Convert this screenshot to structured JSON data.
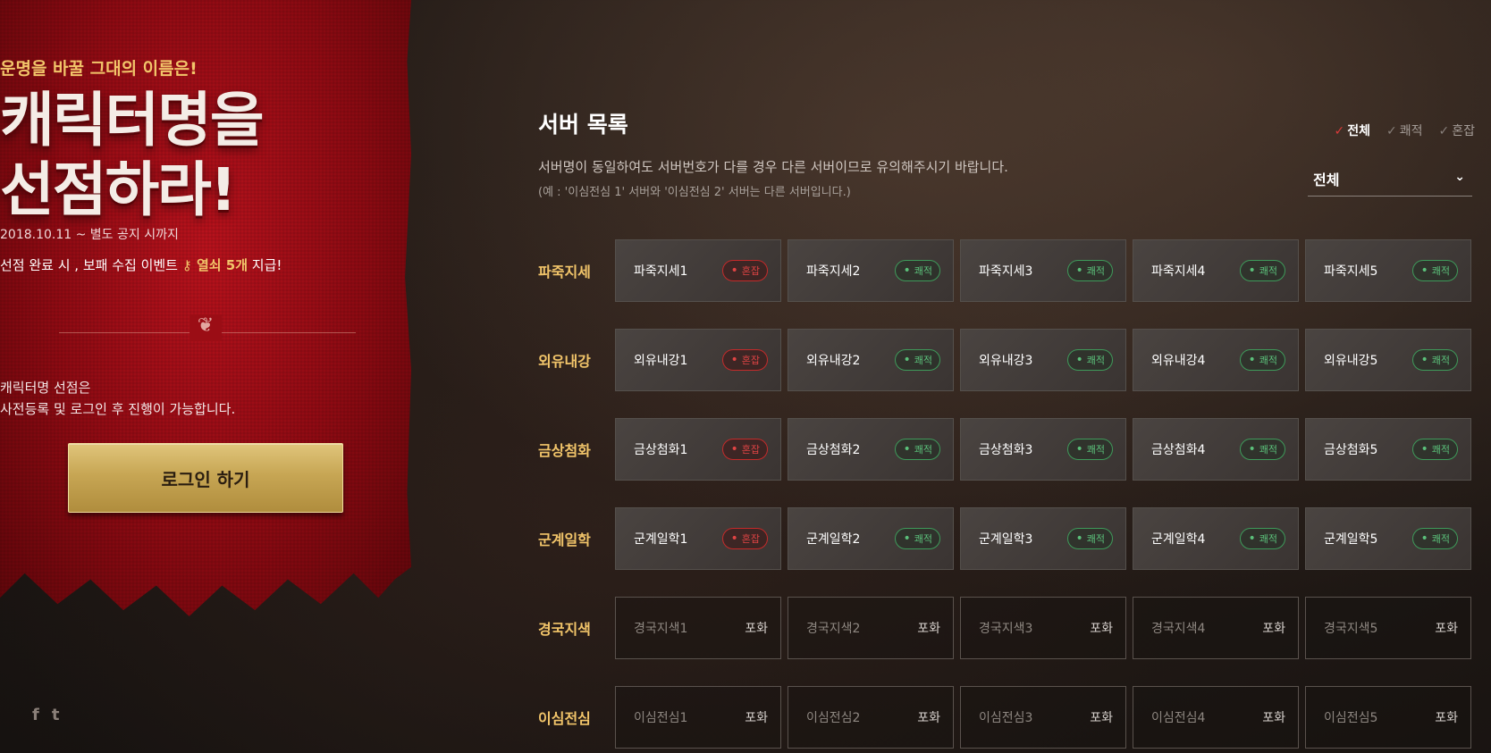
{
  "banner": {
    "tagline": "운명을 바꿀 그대의 이름은!",
    "headline_line1": "캐릭터명을",
    "headline_line2": "선점하라!",
    "period": "2018.10.11 ~ 별도 공지 시까지",
    "event_prefix": "선점 완료 시 , 보패 수집 이벤트 ",
    "event_key": "열쇠 5개",
    "event_suffix": " 지급!",
    "notice_line1": "캐릭터명 선점은",
    "notice_line2": "사전등록 및 로그인 후 진행이 가능합니다.",
    "login_label": "로그인 하기"
  },
  "social": {
    "facebook": "f",
    "twitter": "t"
  },
  "panel": {
    "title": "서버 목록",
    "description": "서버명이 동일하여도 서버번호가 다를 경우 다른 서버이므로 유의해주시기 바랍니다.",
    "description_sub": "(예 : '이심전심 1' 서버와 '이심전심 2' 서버는 다른 서버입니다.)",
    "filters": [
      {
        "label": "전체",
        "active": true
      },
      {
        "label": "쾌적",
        "active": false
      },
      {
        "label": "혼잡",
        "active": false
      }
    ],
    "select_value": "전체"
  },
  "status_labels": {
    "busy": "혼잡",
    "smooth": "쾌적",
    "saturated": "포화"
  },
  "groups": [
    {
      "label": "파죽지세",
      "servers": [
        {
          "name": "파죽지세1",
          "status": "busy"
        },
        {
          "name": "파죽지세2",
          "status": "smooth"
        },
        {
          "name": "파죽지세3",
          "status": "smooth"
        },
        {
          "name": "파죽지세4",
          "status": "smooth"
        },
        {
          "name": "파죽지세5",
          "status": "smooth"
        }
      ]
    },
    {
      "label": "외유내강",
      "servers": [
        {
          "name": "외유내강1",
          "status": "busy"
        },
        {
          "name": "외유내강2",
          "status": "smooth"
        },
        {
          "name": "외유내강3",
          "status": "smooth"
        },
        {
          "name": "외유내강4",
          "status": "smooth"
        },
        {
          "name": "외유내강5",
          "status": "smooth"
        }
      ]
    },
    {
      "label": "금상첨화",
      "servers": [
        {
          "name": "금상첨화1",
          "status": "busy"
        },
        {
          "name": "금상첨화2",
          "status": "smooth"
        },
        {
          "name": "금상첨화3",
          "status": "smooth"
        },
        {
          "name": "금상첨화4",
          "status": "smooth"
        },
        {
          "name": "금상첨화5",
          "status": "smooth"
        }
      ]
    },
    {
      "label": "군계일학",
      "servers": [
        {
          "name": "군계일학1",
          "status": "busy"
        },
        {
          "name": "군계일학2",
          "status": "smooth"
        },
        {
          "name": "군계일학3",
          "status": "smooth"
        },
        {
          "name": "군계일학4",
          "status": "smooth"
        },
        {
          "name": "군계일학5",
          "status": "smooth"
        }
      ]
    },
    {
      "label": "경국지색",
      "servers": [
        {
          "name": "경국지색1",
          "status": "saturated"
        },
        {
          "name": "경국지색2",
          "status": "saturated"
        },
        {
          "name": "경국지색3",
          "status": "saturated"
        },
        {
          "name": "경국지색4",
          "status": "saturated"
        },
        {
          "name": "경국지색5",
          "status": "saturated"
        }
      ]
    },
    {
      "label": "이심전심",
      "servers": [
        {
          "name": "이심전심1",
          "status": "saturated"
        },
        {
          "name": "이심전심2",
          "status": "saturated"
        },
        {
          "name": "이심전심3",
          "status": "saturated"
        },
        {
          "name": "이심전심4",
          "status": "saturated"
        },
        {
          "name": "이심전심5",
          "status": "saturated"
        }
      ]
    }
  ]
}
